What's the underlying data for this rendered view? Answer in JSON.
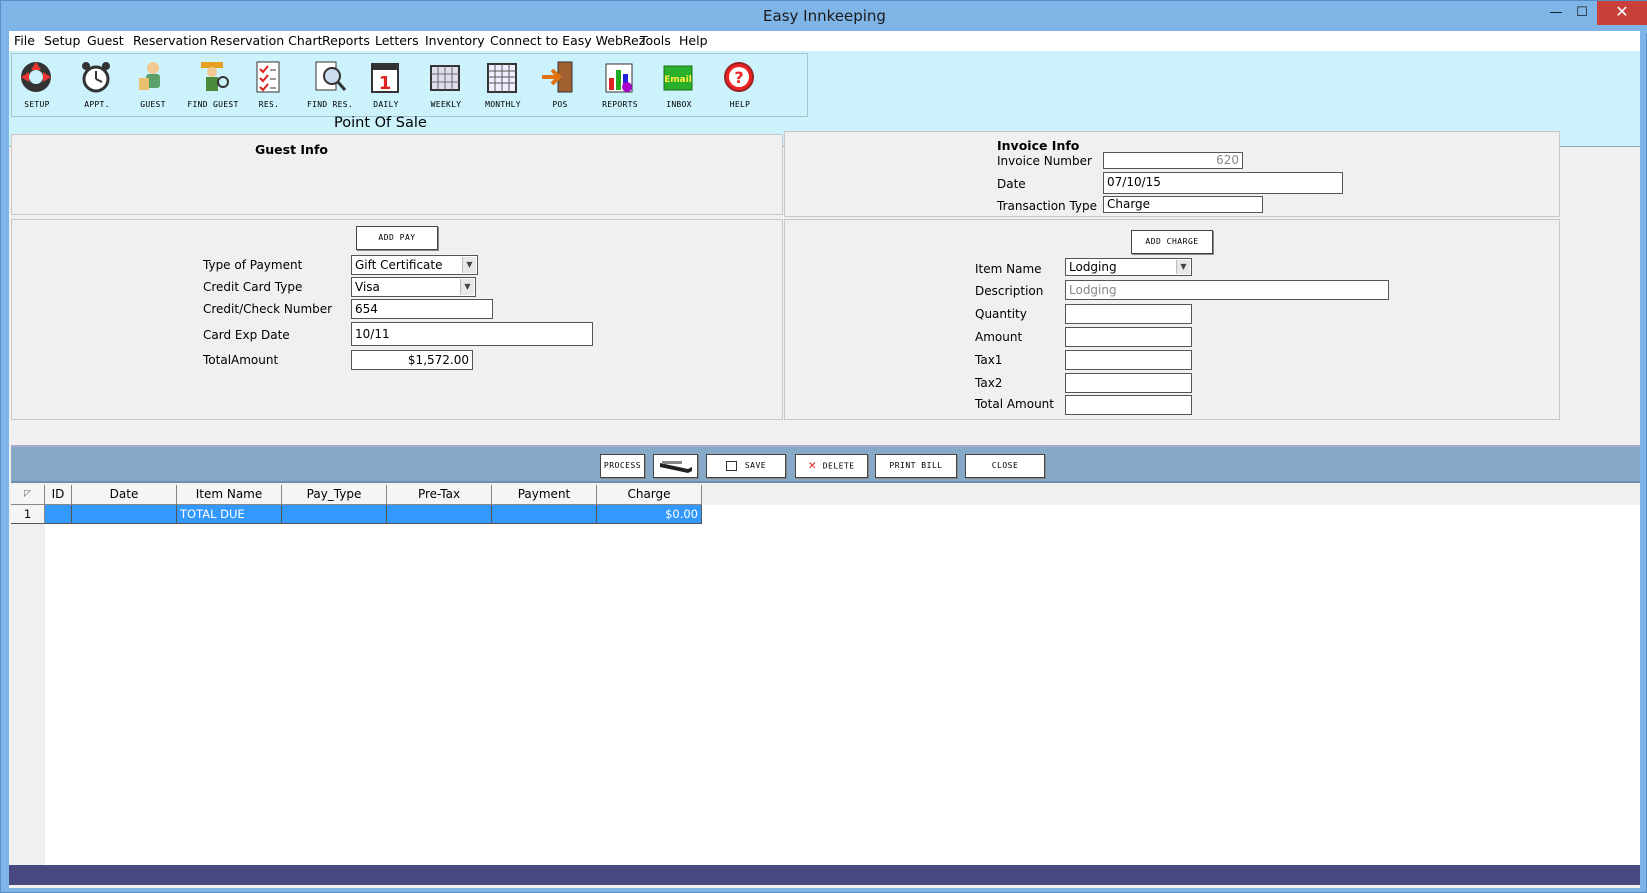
{
  "window": {
    "title": "Easy Innkeeping",
    "min_glyph": "—",
    "max_glyph": "☐",
    "close_glyph": "✕"
  },
  "menu": [
    "File",
    "Setup",
    "Guest",
    "Reservation",
    "Reservation Chart",
    "Reports",
    "Letters",
    "Inventory",
    "Connect to Easy WebRez",
    "Tools",
    "Help"
  ],
  "toolbar": [
    "SETUP",
    "APPT.",
    "GUEST",
    "FIND GUEST",
    "RES.",
    "FIND RES.",
    "DAILY",
    "WEEKLY",
    "MONTHLY",
    "POS",
    "REPORTS",
    "INBOX",
    "HELP"
  ],
  "page_title": "Point Of Sale",
  "guest_info": {
    "heading": "Guest Info"
  },
  "invoice": {
    "heading": "Invoice Info",
    "number_label": "Invoice Number",
    "number": "620",
    "date_label": "Date",
    "date": "07/10/15",
    "type_label": "Transaction Type",
    "type": "Charge"
  },
  "payment": {
    "add_label": "ADD PAY",
    "type_label": "Type of Payment",
    "type": "Gift Certificate",
    "cc_type_label": "Credit Card Type",
    "cc_type": "Visa",
    "number_label": "Credit/Check Number",
    "number": "654",
    "exp_label": "Card Exp Date",
    "exp": "10/11",
    "total_label": "TotalAmount",
    "total": "$1,572.00"
  },
  "charge": {
    "add_label": "ADD CHARGE",
    "item_label": "Item Name",
    "item": "Lodging",
    "desc_label": "Description",
    "desc": "Lodging",
    "qty_label": "Quantity",
    "qty": "",
    "amount_label": "Amount",
    "amount": "",
    "tax1_label": "Tax1",
    "tax1": "",
    "tax2_label": "Tax2",
    "tax2": "",
    "total_label": "Total Amount",
    "total": ""
  },
  "actions": {
    "process": "PROCESS",
    "save": "SAVE",
    "delete": "DELETE",
    "print": "PRINT BILL",
    "close": "CLOSE"
  },
  "grid": {
    "columns": [
      "ID",
      "Date",
      "Item Name",
      "Pay_Type",
      "Pre-Tax",
      "Payment",
      "Charge"
    ],
    "corner_glyph": "◸",
    "rows": [
      {
        "num": "1",
        "id": "",
        "date": "",
        "item": "TOTAL DUE",
        "pay_type": "",
        "pretax": "",
        "payment": "",
        "charge": "$0.00"
      }
    ]
  },
  "icons": {
    "setup": "lifebuoy-icon",
    "appt": "alarm-clock-icon",
    "guest": "person-icon",
    "find_guest": "find-person-icon",
    "res": "checklist-icon",
    "find_res": "magnifier-doc-icon",
    "daily": "calendar-day-icon",
    "weekly": "calendar-week-icon",
    "monthly": "calendar-month-icon",
    "pos": "door-arrow-icon",
    "reports": "bar-chart-icon",
    "inbox": "email-icon",
    "help": "help-icon",
    "card_reader": "card-reader-icon"
  },
  "inbox_glyph": "Email",
  "help_glyph": "?",
  "daily_glyph": "1",
  "delete_glyph": "✕"
}
